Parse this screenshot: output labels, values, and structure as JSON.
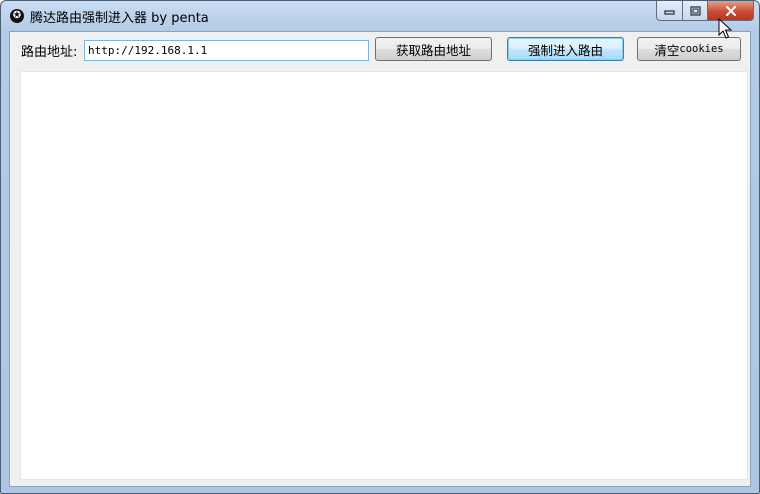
{
  "window": {
    "title": "腾达路由强制进入器 by penta",
    "app_icon_glyph": "✪",
    "caption": {
      "minimize_glyph": "▭",
      "maximize_glyph": "▣",
      "close_glyph": "✕"
    }
  },
  "toolbar": {
    "address_label": "路由地址:",
    "address_value": "http://192.168.1.1",
    "get_address_button": "获取路由地址",
    "force_enter_button": "强制进入路由",
    "clear_prefix": "清空",
    "clear_suffix": "cookies"
  },
  "colors": {
    "title_gradient_top": "#c9dcf2",
    "close_button": "#c84d34",
    "focused_button_border": "#3c7fb1",
    "input_border": "#7fb5dd"
  },
  "icons": {
    "app": "app-icon",
    "minimize": "minimize-icon",
    "maximize": "maximize-icon",
    "close": "close-icon",
    "cursor": "mouse-pointer-icon"
  }
}
